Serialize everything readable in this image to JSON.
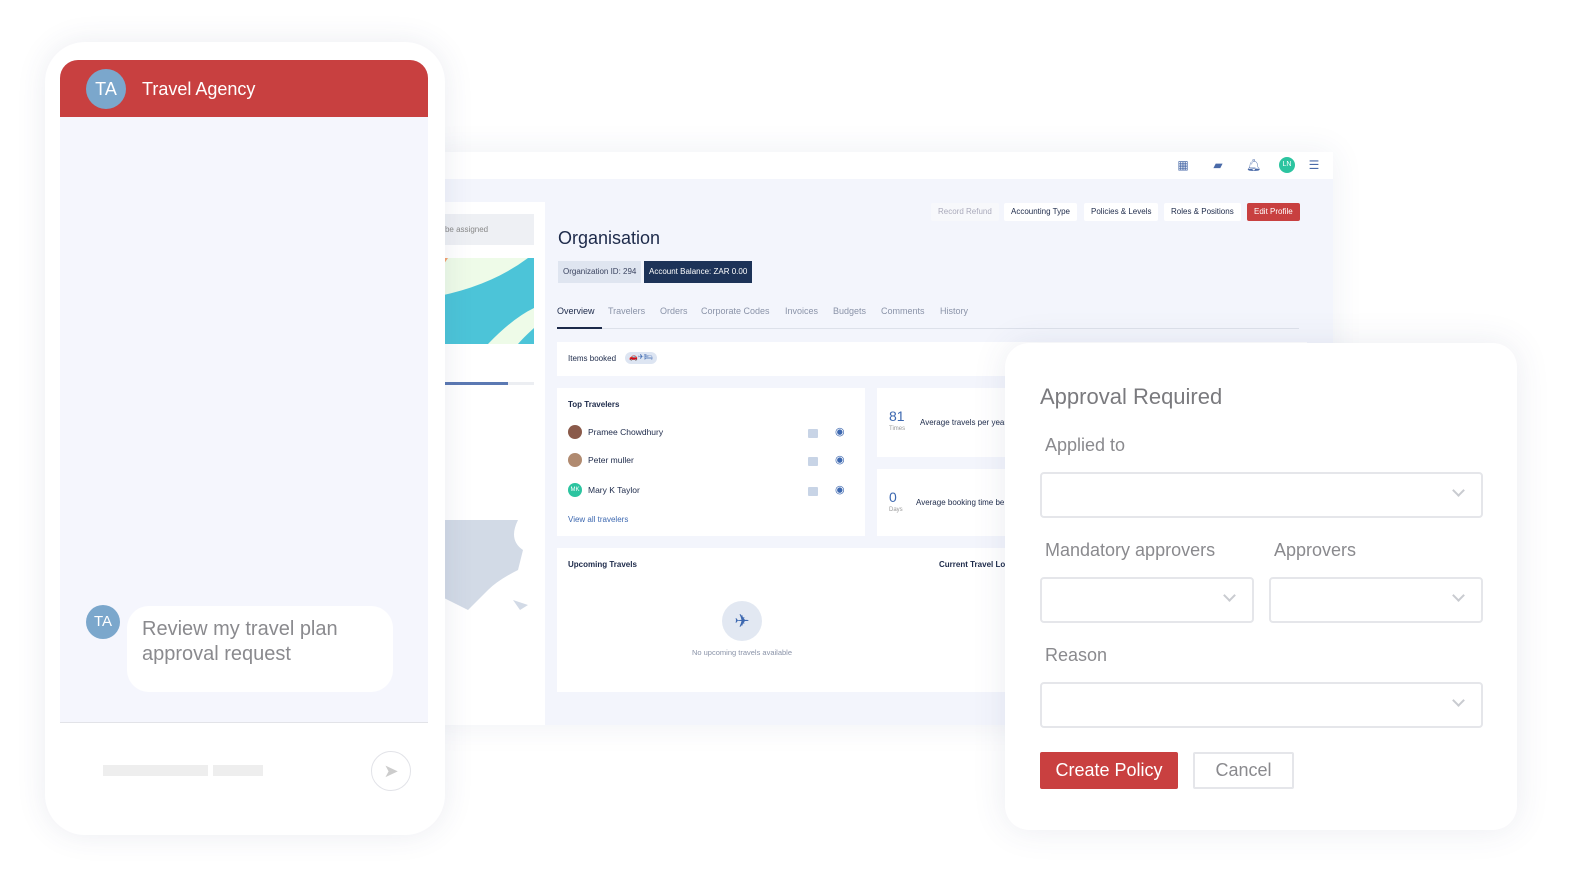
{
  "dashboard": {
    "sidebar": {
      "assigned_text": ": To be assigned",
      "progress_percent": 75
    },
    "header_buttons": [
      "Record Refund",
      "Accounting Type",
      "Policies & Levels",
      "Roles & Positions",
      "Edit Profile"
    ],
    "title": "Organisation",
    "org_id": "Organization ID: 294",
    "balance": "Account Balance: ZAR 0.00",
    "tabs": [
      "Overview",
      "Travelers",
      "Orders",
      "Corporate Codes",
      "Invoices",
      "Budgets",
      "Comments",
      "History"
    ],
    "active_tab": "Overview",
    "items_booked": "Items booked",
    "top_travelers": {
      "title": "Top Travelers",
      "people": [
        {
          "name": "Pramee Chowdhury"
        },
        {
          "name": "Peter muller"
        },
        {
          "name": "Mary K Taylor",
          "initials": "MK"
        }
      ],
      "view_all": "View all travelers"
    },
    "stats": [
      {
        "value": "81",
        "unit": "Times",
        "label": "Average travels per year"
      },
      {
        "value": "0",
        "unit": "Days",
        "label": "Average booking time be"
      }
    ],
    "upcoming": {
      "title": "Upcoming Travels",
      "empty": "No upcoming travels available"
    },
    "current_location": "Current Travel Lo",
    "user_initials": "LN"
  },
  "phone": {
    "title": "Travel Agency",
    "initials": "TA",
    "message": "Review my travel plan approval request"
  },
  "approval": {
    "title": "Approval Required",
    "applied_to": "Applied to",
    "mandatory": "Mandatory approvers",
    "approvers": "Approvers",
    "reason": "Reason",
    "create": "Create Policy",
    "cancel": "Cancel"
  },
  "colors": {
    "brand_red": "#c84040",
    "navy": "#1d2a4a",
    "accent_blue": "#3d68b0"
  }
}
